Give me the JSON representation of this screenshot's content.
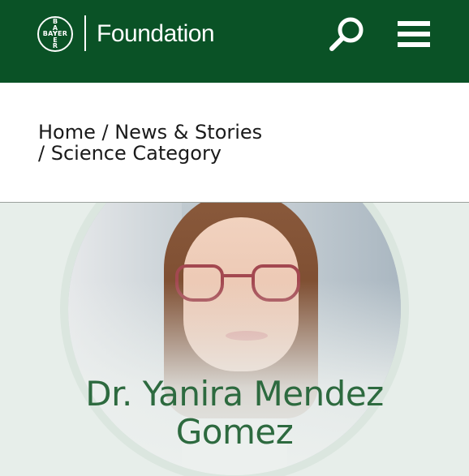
{
  "header": {
    "logo_horizontal": "BAYER",
    "logo_vertical": "BAYER",
    "brand_label": "Foundation",
    "search_icon": "search-icon",
    "menu_icon": "hamburger-menu-icon",
    "background_color": "#0a5226"
  },
  "breadcrumb": {
    "home": "Home",
    "sep1": " / ",
    "news": "News & Stories",
    "sep2": "/ ",
    "category": "Science Category"
  },
  "hero": {
    "name_line1": "Dr. Yanira Mendez",
    "name_line2": "Gomez",
    "name_color": "#2d6a3f",
    "background_color": "#e7eeea"
  }
}
